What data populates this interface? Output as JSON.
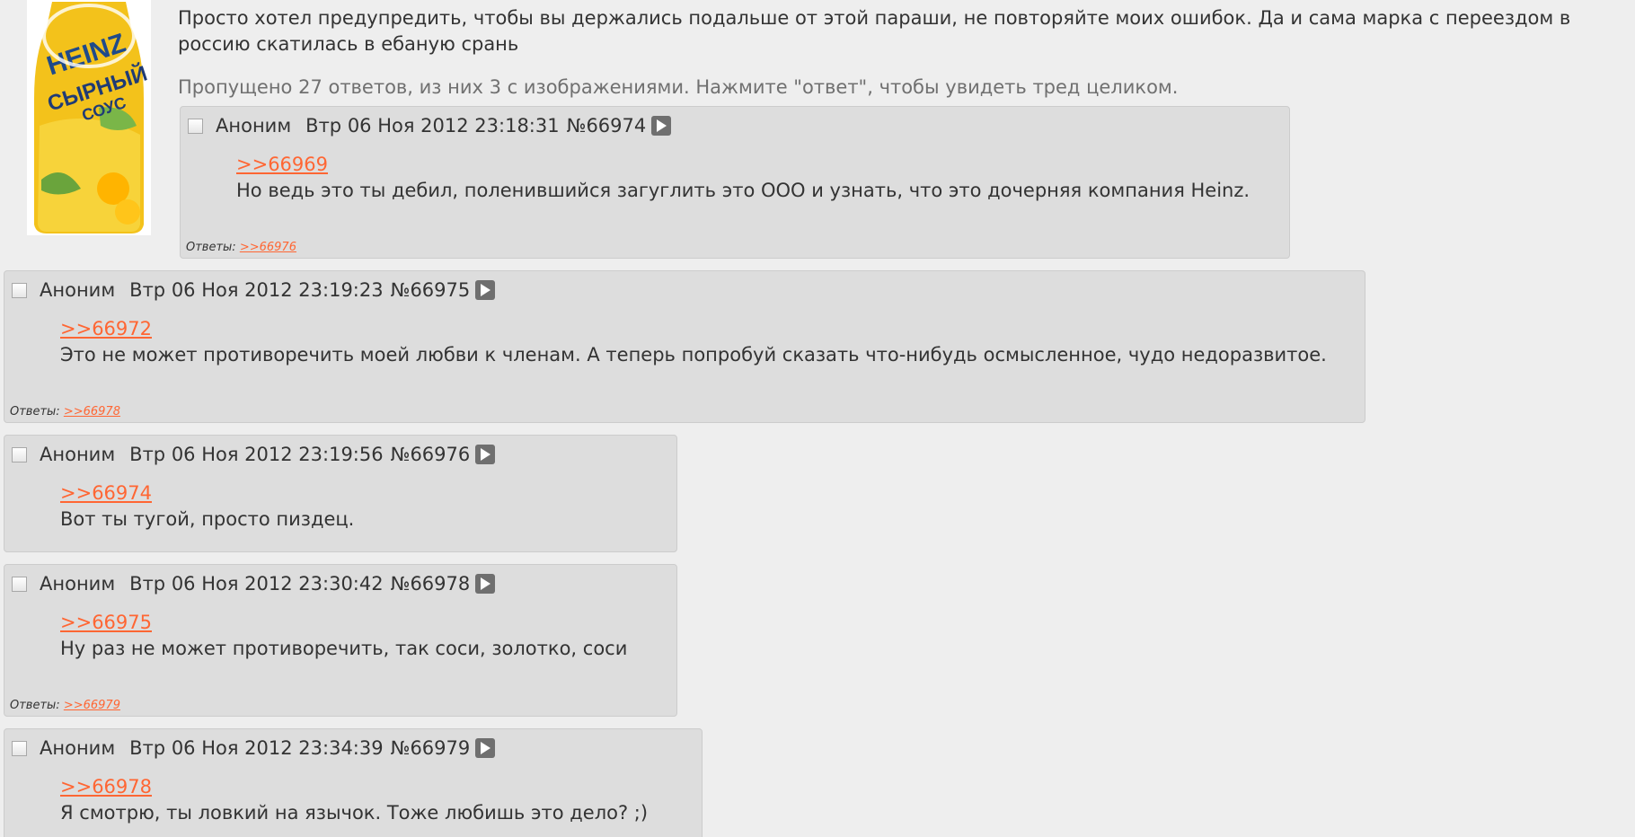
{
  "op": {
    "image_alt": "Heinz cheese sauce bottle",
    "image_text": {
      "brand": "HEINZ",
      "line1": "СЫРНЫЙ",
      "line2": "СОУС"
    },
    "text": "Просто хотел предупредить, чтобы вы держались подальше от этой параши, не повторяйте моих ошибок. Да и сама марка с переездом в россию скатилась в ебаную срань"
  },
  "omitted": "Пропущено 27 ответов, из них 3 с изображениями. Нажмите \"ответ\", чтобы увидеть тред целиком.",
  "replies_label": "Ответы:",
  "colors": {
    "post_bg": "#dddddd",
    "page_bg": "#eeeeee",
    "link": "#ff6633",
    "expand_button": "#6f6f6f"
  },
  "posts": [
    {
      "author": "Аноним",
      "date": "Втр 06 Ноя 2012 23:18:31",
      "number": "№66974",
      "reply_to": ">>66969",
      "text": "Но ведь это ты дебил, поленившийся загуглить это ООО и узнать, что это дочерняя компания Heinz.",
      "replies": ">>66976"
    },
    {
      "author": "Аноним",
      "date": "Втр 06 Ноя 2012 23:19:23",
      "number": "№66975",
      "reply_to": ">>66972",
      "text": "Это не может противоречить моей любви к членам. А теперь попробуй сказать что-нибудь осмысленное, чудо недоразвитое.",
      "replies": ">>66978"
    },
    {
      "author": "Аноним",
      "date": "Втр 06 Ноя 2012 23:19:56",
      "number": "№66976",
      "reply_to": ">>66974",
      "text": "Вот ты тугой, просто пиздец."
    },
    {
      "author": "Аноним",
      "date": "Втр 06 Ноя 2012 23:30:42",
      "number": "№66978",
      "reply_to": ">>66975",
      "text": "Ну раз не может противоречить, так соси, золотко, соси",
      "replies": ">>66979"
    },
    {
      "author": "Аноним",
      "date": "Втр 06 Ноя 2012 23:34:39",
      "number": "№66979",
      "reply_to": ">>66978",
      "text": "Я смотрю, ты ловкий на язычок. Тоже любишь это дело? ;)"
    }
  ]
}
